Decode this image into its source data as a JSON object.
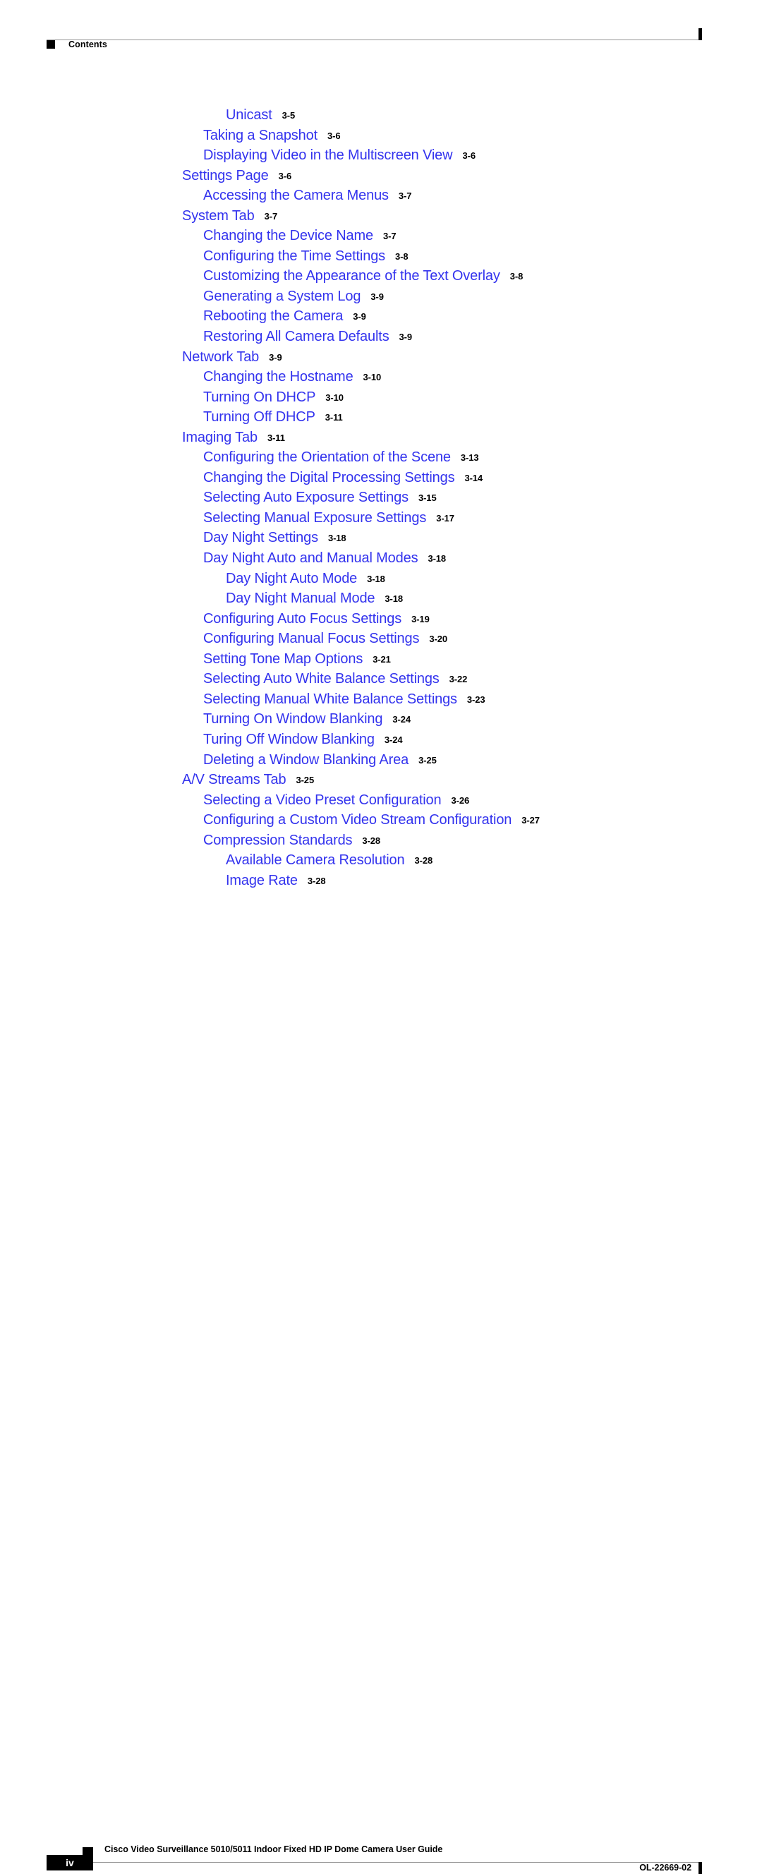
{
  "header": {
    "label": "Contents",
    "square_icon": "black-square-bullet-icon"
  },
  "colors": {
    "link_blue": "#3333ee",
    "text_black": "#000000",
    "rule_gray": "#959595"
  },
  "toc": {
    "entries": [
      {
        "title": "Unicast",
        "page": "3-5",
        "level": 3
      },
      {
        "title": "Taking a Snapshot",
        "page": "3-6",
        "level": 2
      },
      {
        "title": "Displaying Video in the Multiscreen View",
        "page": "3-6",
        "level": 2
      },
      {
        "title": "Settings Page",
        "page": "3-6",
        "level": 1
      },
      {
        "title": "Accessing the Camera Menus",
        "page": "3-7",
        "level": 2
      },
      {
        "title": "System Tab",
        "page": "3-7",
        "level": 1
      },
      {
        "title": "Changing the Device Name",
        "page": "3-7",
        "level": 2
      },
      {
        "title": "Configuring the Time Settings",
        "page": "3-8",
        "level": 2
      },
      {
        "title": "Customizing the Appearance of the Text Overlay",
        "page": "3-8",
        "level": 2
      },
      {
        "title": "Generating a System Log",
        "page": "3-9",
        "level": 2
      },
      {
        "title": "Rebooting the Camera",
        "page": "3-9",
        "level": 2
      },
      {
        "title": "Restoring All Camera Defaults",
        "page": "3-9",
        "level": 2
      },
      {
        "title": "Network Tab",
        "page": "3-9",
        "level": 1
      },
      {
        "title": "Changing the Hostname",
        "page": "3-10",
        "level": 2
      },
      {
        "title": "Turning On DHCP",
        "page": "3-10",
        "level": 2
      },
      {
        "title": "Turning Off DHCP",
        "page": "3-11",
        "level": 2
      },
      {
        "title": "Imaging Tab",
        "page": "3-11",
        "level": 1
      },
      {
        "title": "Configuring the Orientation of the Scene",
        "page": "3-13",
        "level": 2
      },
      {
        "title": "Changing the Digital Processing Settings",
        "page": "3-14",
        "level": 2
      },
      {
        "title": "Selecting Auto Exposure Settings",
        "page": "3-15",
        "level": 2
      },
      {
        "title": "Selecting Manual Exposure Settings",
        "page": "3-17",
        "level": 2
      },
      {
        "title": "Day Night Settings",
        "page": "3-18",
        "level": 2
      },
      {
        "title": "Day Night Auto and Manual Modes",
        "page": "3-18",
        "level": 2
      },
      {
        "title": "Day Night Auto Mode",
        "page": "3-18",
        "level": 3
      },
      {
        "title": "Day Night Manual Mode",
        "page": "3-18",
        "level": 3
      },
      {
        "title": "Configuring Auto Focus Settings",
        "page": "3-19",
        "level": 2
      },
      {
        "title": "Configuring Manual Focus Settings",
        "page": "3-20",
        "level": 2
      },
      {
        "title": "Setting Tone Map Options",
        "page": "3-21",
        "level": 2
      },
      {
        "title": "Selecting Auto White Balance Settings",
        "page": "3-22",
        "level": 2
      },
      {
        "title": "Selecting Manual White Balance Settings",
        "page": "3-23",
        "level": 2
      },
      {
        "title": "Turning On Window Blanking",
        "page": "3-24",
        "level": 2
      },
      {
        "title": "Turing Off Window Blanking",
        "page": "3-24",
        "level": 2
      },
      {
        "title": "Deleting a Window Blanking Area",
        "page": "3-25",
        "level": 2
      },
      {
        "title": "A/V Streams Tab",
        "page": "3-25",
        "level": 1
      },
      {
        "title": "Selecting a Video Preset Configuration",
        "page": "3-26",
        "level": 2
      },
      {
        "title": "Configuring a Custom Video Stream Configuration",
        "page": "3-27",
        "level": 2
      },
      {
        "title": "Compression Standards",
        "page": "3-28",
        "level": 2
      },
      {
        "title": "Available Camera Resolution",
        "page": "3-28",
        "level": 3
      },
      {
        "title": "Image Rate",
        "page": "3-28",
        "level": 3
      }
    ]
  },
  "footer": {
    "page_number": "iv",
    "document_title": "Cisco Video Surveillance 5010/5011 Indoor Fixed HD IP Dome Camera User Guide",
    "document_number": "OL-22669-02",
    "square_icon": "black-square-bullet-icon"
  }
}
